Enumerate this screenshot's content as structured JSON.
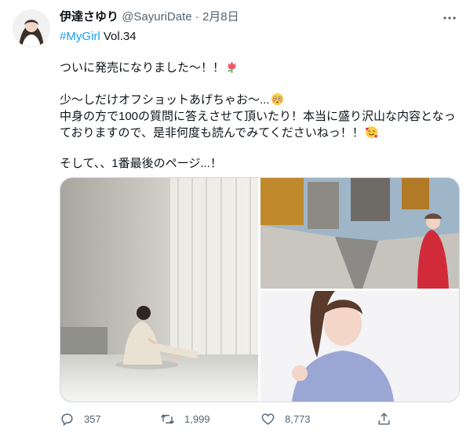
{
  "tweet": {
    "author_name": "伊達さゆり",
    "handle": "@SayuriDate",
    "separator": "·",
    "date": "2月8日",
    "hashtag": "#MyGirl",
    "hashtag_suffix": "Vol.34",
    "lines": [
      "ついに発売になりました〜！！",
      "少〜しだけオフショットあげちゃお〜...",
      "中身の方で100の質問に答えさせて頂いたり！本当に盛り沢山な内容となっ",
      "ておりますので、是非何度も読んでみてくださいねっ！！",
      "そして、、1番最後のページ...！"
    ],
    "emojis": [
      "tulip-emoji",
      "flushed-face-emoji",
      "smiling-face-with-hearts-emoji"
    ]
  },
  "actions": {
    "replies": "357",
    "retweets": "1,999",
    "likes": "8,773"
  },
  "colors": {
    "accent": "#1d9bf0",
    "text": "#0f1419",
    "muted": "#536471",
    "border": "#cfd9de"
  }
}
